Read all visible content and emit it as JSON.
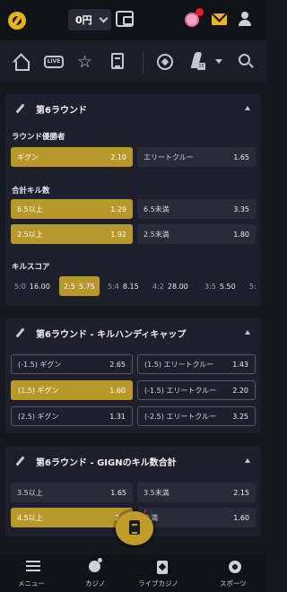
{
  "header": {
    "balance": "0円"
  },
  "cards": [
    {
      "title": "第6ラウンド",
      "sections": [
        {
          "label": "ラウンド優勝者",
          "odds": [
            {
              "label": "ギグン",
              "price": "2.10",
              "selected": true
            },
            {
              "label": "エリートクルー",
              "price": "1.65",
              "selected": false
            }
          ]
        },
        {
          "label": "合計キル数",
          "odds": [
            {
              "label": "6.5以上",
              "price": "1.29",
              "selected": true
            },
            {
              "label": "6.5未満",
              "price": "3.35",
              "selected": false
            },
            {
              "label": "2.5以上",
              "price": "1.92",
              "selected": true
            },
            {
              "label": "2.5未満",
              "price": "1.80",
              "selected": false
            }
          ]
        },
        {
          "label": "キルスコア",
          "scores": [
            {
              "label": "5:0",
              "price": "16.00",
              "selected": false
            },
            {
              "label": "2:5",
              "price": "5.75",
              "selected": true
            },
            {
              "label": "5:4",
              "price": "8.15",
              "selected": false
            },
            {
              "label": "4:2",
              "price": "28.00",
              "selected": false
            },
            {
              "label": "3:5",
              "price": "5.50",
              "selected": false
            },
            {
              "label": "5:",
              "price": "",
              "selected": false
            }
          ]
        }
      ]
    },
    {
      "title": "第6ラウンド - キルハンディキャップ",
      "odds": [
        {
          "label": "(-1.5)  ギグン",
          "price": "2.65",
          "selected": false
        },
        {
          "label": "(1.5)  エリートクルー",
          "price": "1.43",
          "selected": false
        },
        {
          "label": "(1.5)  ギグン",
          "price": "1.60",
          "selected": true
        },
        {
          "label": "(-1.5) エリートクルー",
          "price": "2.20",
          "selected": false
        },
        {
          "label": "(2.5)  ギグン",
          "price": "1.31",
          "selected": false
        },
        {
          "label": "(-2.5) エリートクルー",
          "price": "3.25",
          "selected": false
        }
      ]
    },
    {
      "title": "第6ラウンド - GIGNのキル数合計",
      "odds": [
        {
          "label": "3.5以上",
          "price": "1.65",
          "selected": false
        },
        {
          "label": "3.5未満",
          "price": "2.15",
          "selected": false
        },
        {
          "label": "4.5以上",
          "price": "2.2",
          "selected": true
        },
        {
          "label": "未満",
          "price": "1.60",
          "selected": false
        }
      ]
    }
  ],
  "betslip_badge": "!",
  "bottom_nav": [
    {
      "label": "メニュー",
      "icon": "menu-icon"
    },
    {
      "label": "カジノ",
      "icon": "casino-icon"
    },
    {
      "label": "ライブカジノ",
      "icon": "live-casino-icon"
    },
    {
      "label": "スポーツ",
      "icon": "sports-icon"
    }
  ],
  "colors": {
    "accent": "#b8982a",
    "background": "#16161f",
    "card": "#1f1f2b"
  }
}
